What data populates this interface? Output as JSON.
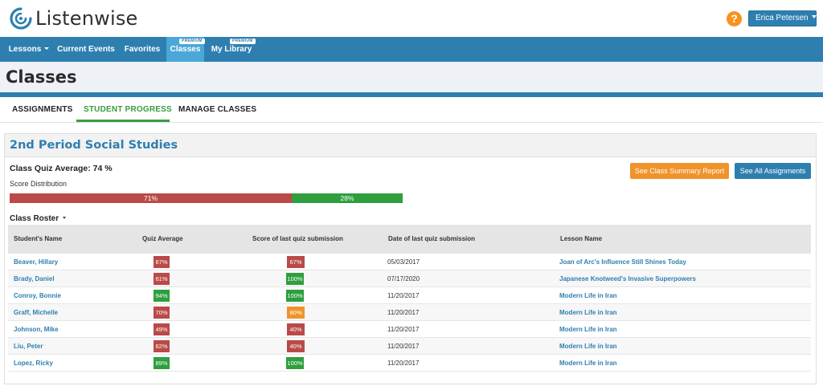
{
  "app": {
    "name": "Listenwise"
  },
  "header": {
    "help_label": "?",
    "user_name": "Erica Petersen"
  },
  "nav": {
    "items": [
      {
        "label": "Lessons",
        "has_caret": true,
        "badge": ""
      },
      {
        "label": "Current Events",
        "has_caret": false,
        "badge": ""
      },
      {
        "label": "Favorites",
        "has_caret": false,
        "badge": ""
      },
      {
        "label": "Classes",
        "has_caret": false,
        "badge": "PREMIUM",
        "active": true
      },
      {
        "label": "My Library",
        "has_caret": false,
        "badge": "PREMIUM"
      }
    ]
  },
  "page": {
    "title": "Classes"
  },
  "tabs": [
    {
      "label": "ASSIGNMENTS",
      "active": false
    },
    {
      "label": "STUDENT PROGRESS",
      "active": true
    },
    {
      "label": "MANAGE CLASSES",
      "active": false
    }
  ],
  "class_panel": {
    "name": "2nd Period Social Studies",
    "quiz_average_label": "Class Quiz Average: 74 %",
    "score_distribution_label": "Score Distribution",
    "distribution": [
      {
        "label": "71%",
        "percent": 71,
        "color": "#b94a48"
      },
      {
        "label": "28%",
        "percent": 28,
        "color": "#2e9e3e"
      }
    ],
    "summary_button": "See Class Summary Report",
    "assignments_button": "See All Assignments",
    "roster_title": "Class Roster"
  },
  "table": {
    "headers": [
      "Student's Name",
      "Quiz Average",
      "Score of last quiz submission",
      "Date of last quiz submission",
      "Lesson Name"
    ],
    "rows": [
      {
        "name": "Beaver, Hillary",
        "quiz_avg": "67%",
        "qa_color": "#b94a48",
        "last_score": "67%",
        "ls_color": "#b94a48",
        "date": "05/03/2017",
        "lesson": "Joan of Arc's Influence Still Shines Today"
      },
      {
        "name": "Brady, Daniel",
        "quiz_avg": "61%",
        "qa_color": "#b94a48",
        "last_score": "100%",
        "ls_color": "#2e9e3e",
        "date": "07/17/2020",
        "lesson": "Japanese Knotweed's Invasive Superpowers"
      },
      {
        "name": "Conroy, Bonnie",
        "quiz_avg": "94%",
        "qa_color": "#2e9e3e",
        "last_score": "100%",
        "ls_color": "#2e9e3e",
        "date": "11/20/2017",
        "lesson": "Modern Life in Iran"
      },
      {
        "name": "Graff, Michelle",
        "quiz_avg": "70%",
        "qa_color": "#b94a48",
        "last_score": "80%",
        "ls_color": "#f0932b",
        "date": "11/20/2017",
        "lesson": "Modern Life in Iran"
      },
      {
        "name": "Johnson, Mike",
        "quiz_avg": "49%",
        "qa_color": "#b94a48",
        "last_score": "40%",
        "ls_color": "#b94a48",
        "date": "11/20/2017",
        "lesson": "Modern Life in Iran"
      },
      {
        "name": "Liu, Peter",
        "quiz_avg": "62%",
        "qa_color": "#b94a48",
        "last_score": "40%",
        "ls_color": "#b94a48",
        "date": "11/20/2017",
        "lesson": "Modern Life in Iran"
      },
      {
        "name": "Lopez, Ricky",
        "quiz_avg": "89%",
        "qa_color": "#2e9e3e",
        "last_score": "100%",
        "ls_color": "#2e9e3e",
        "date": "11/20/2017",
        "lesson": "Modern Life in Iran"
      }
    ]
  },
  "icons": {
    "logo": "listenwise-logo-icon",
    "help": "question-circle-icon",
    "caret": "caret-down-icon"
  },
  "colors": {
    "brand_blue": "#2e7fb0",
    "active_nav": "#4aa7d8",
    "green": "#2e9e3e",
    "red": "#b94a48",
    "orange": "#f0932b"
  }
}
